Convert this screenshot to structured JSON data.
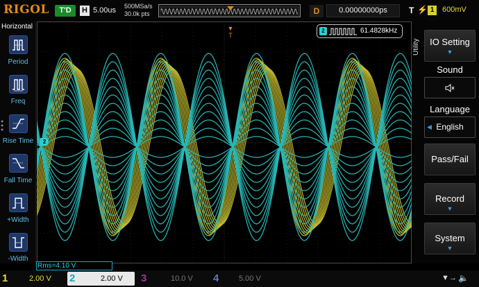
{
  "topbar": {
    "logo": "RIGOL",
    "run_status": "T'D",
    "horizontal_label": "H",
    "timebase": "5.00us",
    "sample_rate": "500MSa/s",
    "memory_depth": "30.0k pts",
    "delay_label": "D",
    "delay_value": "0.00000000ps",
    "trigger_label": "T",
    "trigger_source": "1",
    "trigger_level": "600mV"
  },
  "left_menu": {
    "title": "Horizontal",
    "items": [
      {
        "label": "Period",
        "icon": "period-icon"
      },
      {
        "label": "Freq",
        "icon": "frequency-icon"
      },
      {
        "label": "Rise Time",
        "icon": "rise-time-icon"
      },
      {
        "label": "Fall Time",
        "icon": "fall-time-icon"
      },
      {
        "label": "+Width",
        "icon": "positive-width-icon"
      },
      {
        "label": "-Width",
        "icon": "negative-width-icon"
      }
    ]
  },
  "screen": {
    "ch2_marker": "2",
    "trigger_right_marker": "T",
    "frequency_channel": "2",
    "frequency_value": "61.4828kHz",
    "rms_readout": "Rms=4.10 V"
  },
  "right_menu": {
    "tab_label": "Utility",
    "io_setting": "IO Setting",
    "sound_label": "Sound",
    "language_label": "Language",
    "language_value": "English",
    "pass_fail": "Pass/Fail",
    "record": "Record",
    "system": "System"
  },
  "channels": [
    {
      "num": "1",
      "scale": "2.00 V",
      "color": "#e6dc3a",
      "active": true
    },
    {
      "num": "2",
      "scale": "2.00 V",
      "color": "#2ad0d0",
      "active": true
    },
    {
      "num": "3",
      "scale": "10.0 V",
      "color": "#b040b0",
      "active": false
    },
    {
      "num": "4",
      "scale": "5.00 V",
      "color": "#4a7ae8",
      "active": false
    }
  ],
  "colors": {
    "ch1": "#c8c030",
    "ch2": "#28b8b8",
    "accent": "#e08a1a",
    "menu_blue": "#3a9ae8"
  }
}
